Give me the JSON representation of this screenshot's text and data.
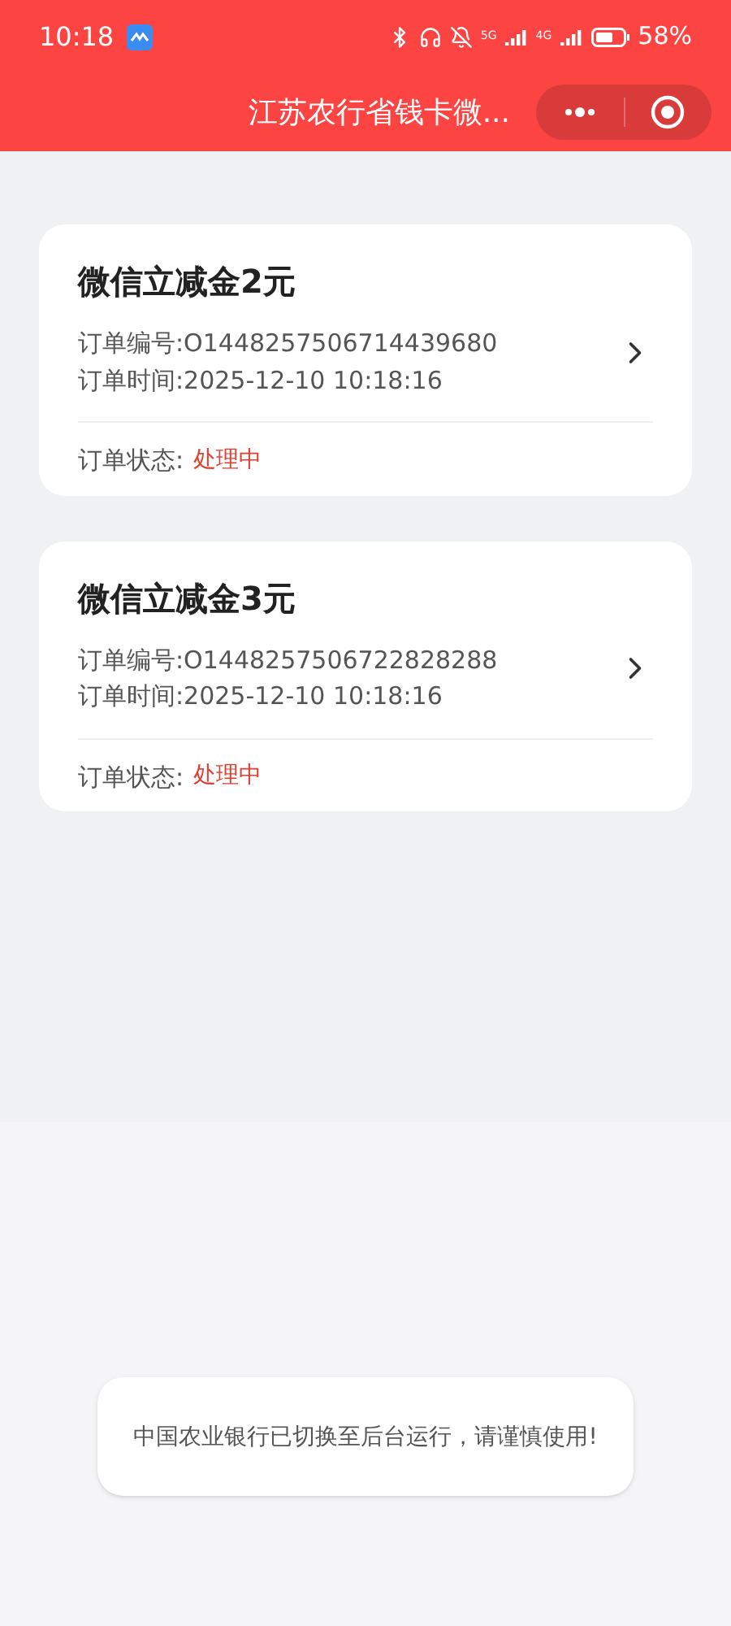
{
  "status_bar": {
    "time": "10:18",
    "network_1": "5G",
    "network_2": "4G",
    "battery": "58%"
  },
  "header": {
    "title": "江苏农行省钱卡微..."
  },
  "orders": [
    {
      "title": "微信立减金2元",
      "number": "订单编号:O1448257506714439680",
      "time": "订单时间:2025-12-10 10:18:16",
      "status_label": "订单状态:",
      "status": "处理中"
    },
    {
      "title": "微信立减金3元",
      "number": "订单编号:O1448257506722828288",
      "time": "订单时间:2025-12-10 10:18:16",
      "status_label": "订单状态:",
      "status": "处理中"
    }
  ],
  "toast": {
    "message": "中国农业银行已切换至后台运行，请谨慎使用!"
  }
}
